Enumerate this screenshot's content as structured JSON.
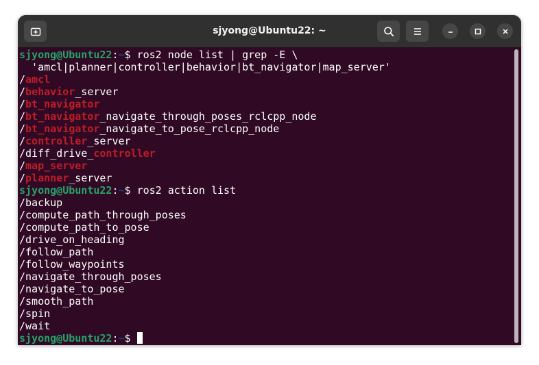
{
  "window": {
    "title": "sjyong@Ubuntu22: ~"
  },
  "headerbar": {
    "new_tab_icon": "new-tab-icon",
    "search_icon": "search-icon",
    "menu_icon": "hamburger-menu-icon",
    "minimize_icon": "minimize-icon",
    "maximize_icon": "maximize-icon",
    "close_icon": "close-icon"
  },
  "colors": {
    "background": "#300a24",
    "titlebar": "#303030",
    "prompt_user": "#26a269",
    "prompt_path": "#12488b",
    "grep_match": "#c01c28",
    "text": "#ffffff"
  },
  "terminal": {
    "prompt": {
      "user_host": "sjyong@Ubuntu22",
      "colon": ":",
      "path": "~",
      "symbol": "$ "
    },
    "lines": [
      {
        "type": "prompt",
        "command": "ros2 node list | grep -E \\"
      },
      {
        "type": "text",
        "segments": [
          {
            "t": "  'amcl|planner|controller|behavior|bt_navigator|map_server'"
          }
        ]
      },
      {
        "type": "text",
        "segments": [
          {
            "t": "/"
          },
          {
            "t": "amcl",
            "hl": true
          }
        ]
      },
      {
        "type": "text",
        "segments": [
          {
            "t": "/"
          },
          {
            "t": "behavior",
            "hl": true
          },
          {
            "t": "_server"
          }
        ]
      },
      {
        "type": "text",
        "segments": [
          {
            "t": "/"
          },
          {
            "t": "bt_navigator",
            "hl": true
          }
        ]
      },
      {
        "type": "text",
        "segments": [
          {
            "t": "/"
          },
          {
            "t": "bt_navigator",
            "hl": true
          },
          {
            "t": "_navigate_through_poses_rclcpp_node"
          }
        ]
      },
      {
        "type": "text",
        "segments": [
          {
            "t": "/"
          },
          {
            "t": "bt_navigator",
            "hl": true
          },
          {
            "t": "_navigate_to_pose_rclcpp_node"
          }
        ]
      },
      {
        "type": "text",
        "segments": [
          {
            "t": "/"
          },
          {
            "t": "controller",
            "hl": true
          },
          {
            "t": "_server"
          }
        ]
      },
      {
        "type": "text",
        "segments": [
          {
            "t": "/diff_drive_"
          },
          {
            "t": "controller",
            "hl": true
          }
        ]
      },
      {
        "type": "text",
        "segments": [
          {
            "t": "/"
          },
          {
            "t": "map_server",
            "hl": true
          }
        ]
      },
      {
        "type": "text",
        "segments": [
          {
            "t": "/"
          },
          {
            "t": "planner",
            "hl": true
          },
          {
            "t": "_server"
          }
        ]
      },
      {
        "type": "prompt",
        "command": "ros2 action list"
      },
      {
        "type": "text",
        "segments": [
          {
            "t": "/backup"
          }
        ]
      },
      {
        "type": "text",
        "segments": [
          {
            "t": "/compute_path_through_poses"
          }
        ]
      },
      {
        "type": "text",
        "segments": [
          {
            "t": "/compute_path_to_pose"
          }
        ]
      },
      {
        "type": "text",
        "segments": [
          {
            "t": "/drive_on_heading"
          }
        ]
      },
      {
        "type": "text",
        "segments": [
          {
            "t": "/follow_path"
          }
        ]
      },
      {
        "type": "text",
        "segments": [
          {
            "t": "/follow_waypoints"
          }
        ]
      },
      {
        "type": "text",
        "segments": [
          {
            "t": "/navigate_through_poses"
          }
        ]
      },
      {
        "type": "text",
        "segments": [
          {
            "t": "/navigate_to_pose"
          }
        ]
      },
      {
        "type": "text",
        "segments": [
          {
            "t": "/smooth_path"
          }
        ]
      },
      {
        "type": "text",
        "segments": [
          {
            "t": "/spin"
          }
        ]
      },
      {
        "type": "text",
        "segments": [
          {
            "t": "/wait"
          }
        ]
      },
      {
        "type": "prompt",
        "command": "",
        "cursor": true
      }
    ]
  }
}
